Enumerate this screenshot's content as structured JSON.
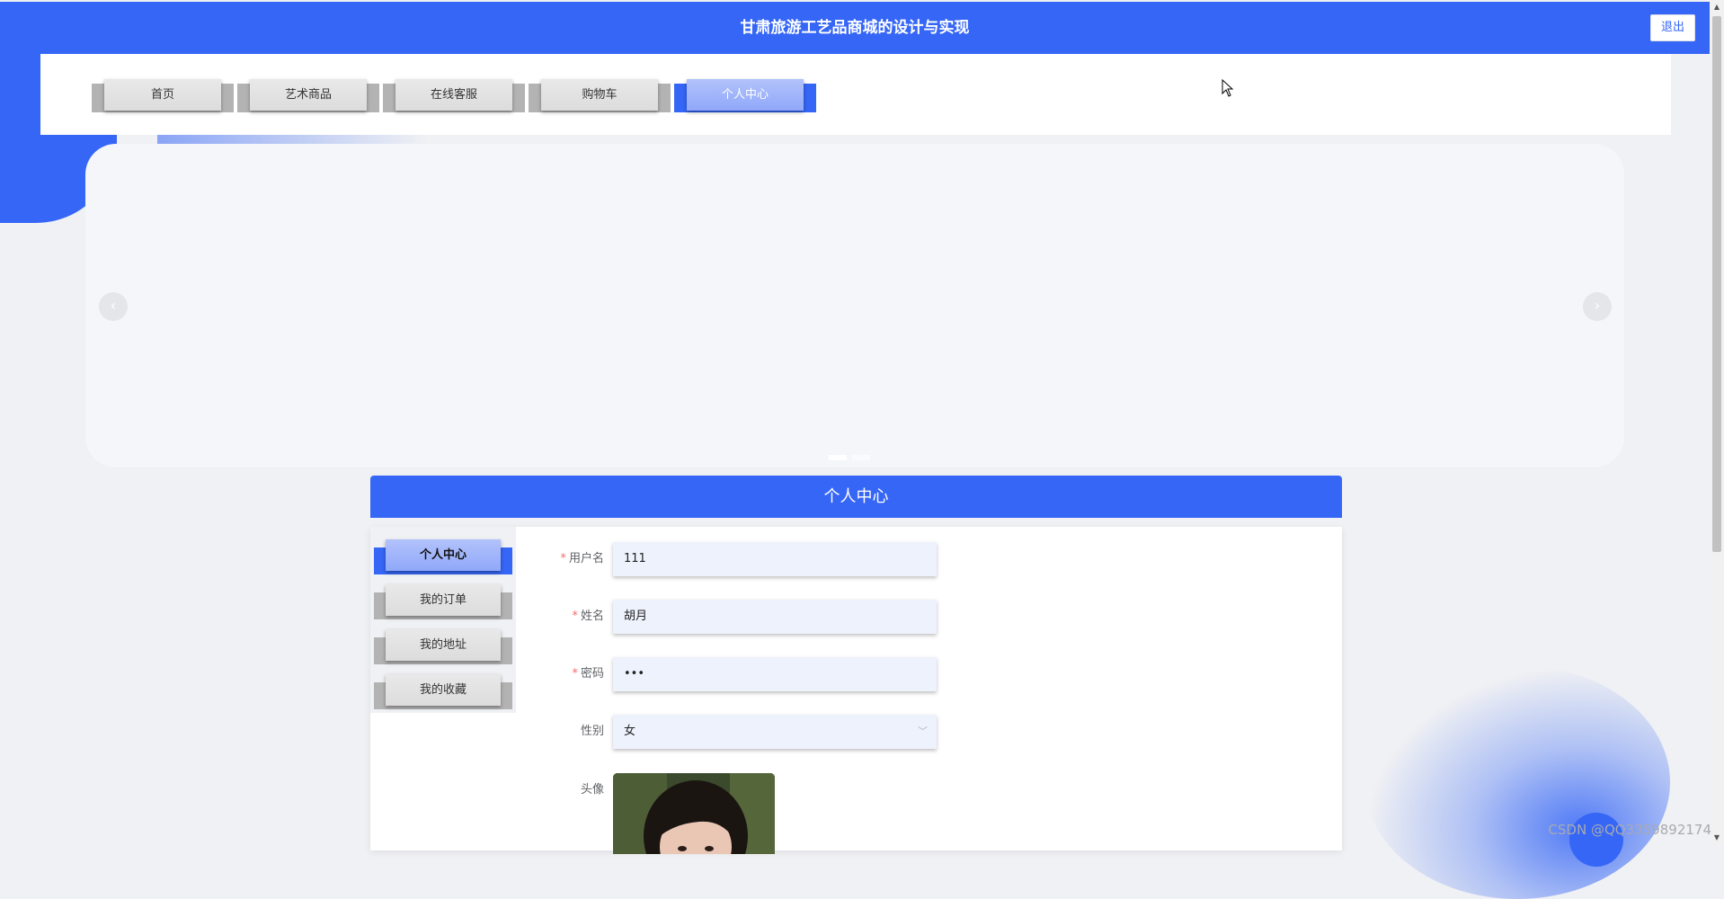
{
  "header": {
    "title": "甘肃旅游工艺品商城的设计与实现",
    "logout_label": "退出"
  },
  "nav": {
    "items": [
      {
        "label": "首页"
      },
      {
        "label": "艺术商品"
      },
      {
        "label": "在线客服"
      },
      {
        "label": "购物车"
      },
      {
        "label": "个人中心",
        "active": true
      }
    ]
  },
  "banner": {
    "prev_icon": "chevron-left",
    "next_icon": "chevron-right",
    "prev_glyph": "‹",
    "next_glyph": "›",
    "active_slide": 1,
    "slide_count": 2
  },
  "section": {
    "title": "个人中心"
  },
  "side_menu": {
    "items": [
      {
        "label": "个人中心",
        "active": true
      },
      {
        "label": "我的订单"
      },
      {
        "label": "我的地址"
      },
      {
        "label": "我的收藏"
      }
    ]
  },
  "form": {
    "required_mark": "*",
    "username": {
      "label": "用户名",
      "value": "111",
      "required": true
    },
    "name": {
      "label": "姓名",
      "value": "胡月",
      "required": true
    },
    "password": {
      "label": "密码",
      "value": "•••",
      "required": true
    },
    "gender": {
      "label": "性别",
      "value": "女",
      "arrow_glyph": "﹀"
    },
    "avatar": {
      "label": "头像"
    }
  },
  "watermark": "CSDN @QQ3359892174",
  "colors": {
    "primary": "#3566f6",
    "page_bg": "#f0f1f4",
    "active_tab_face": "#a5b8fa",
    "input_bg": "#eef2fd",
    "required": "#f56c6c"
  }
}
